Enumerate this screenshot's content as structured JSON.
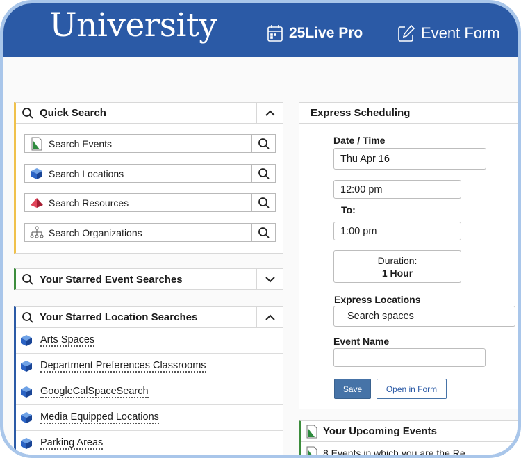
{
  "header": {
    "logo": "University",
    "nav": [
      {
        "label": "25Live Pro",
        "icon": "calendar-icon"
      },
      {
        "label": "Event Form",
        "icon": "edit-form-icon"
      }
    ]
  },
  "quick_search": {
    "title": "Quick Search",
    "items": [
      {
        "label": "Search Events",
        "icon": "event-icon"
      },
      {
        "label": "Search Locations",
        "icon": "location-cube-icon"
      },
      {
        "label": "Search Resources",
        "icon": "resource-pyramid-icon"
      },
      {
        "label": "Search Organizations",
        "icon": "organization-icon"
      }
    ]
  },
  "starred_events": {
    "title": "Your Starred Event Searches"
  },
  "starred_locations": {
    "title": "Your Starred Location Searches",
    "items": [
      {
        "label": "Arts Spaces"
      },
      {
        "label": "Department Preferences Classrooms"
      },
      {
        "label": "GoogleCalSpaceSearch"
      },
      {
        "label": "Media Equipped Locations"
      },
      {
        "label": "Parking Areas"
      }
    ]
  },
  "express": {
    "title": "Express Scheduling",
    "date_time_label": "Date / Time",
    "date": "Thu Apr 16",
    "start_time": "12:00 pm",
    "to_label": "To:",
    "end_time": "1:00 pm",
    "duration_label": "Duration:",
    "duration_value": "1 Hour",
    "locations_label": "Express Locations",
    "locations_value": "Search spaces",
    "event_name_label": "Event Name",
    "event_name_value": "",
    "save_label": "Save",
    "open_form_label": "Open in Form"
  },
  "upcoming": {
    "title": "Your Upcoming Events",
    "row_text": "8 Events in which you are the  Re"
  },
  "colors": {
    "header_bg": "#2b5aa6",
    "quick_search_accent": "#f0c14b",
    "starred_events_accent": "#3c8d3c",
    "starred_locations_accent": "#2b5aa6",
    "save_button": "#4673a7"
  }
}
